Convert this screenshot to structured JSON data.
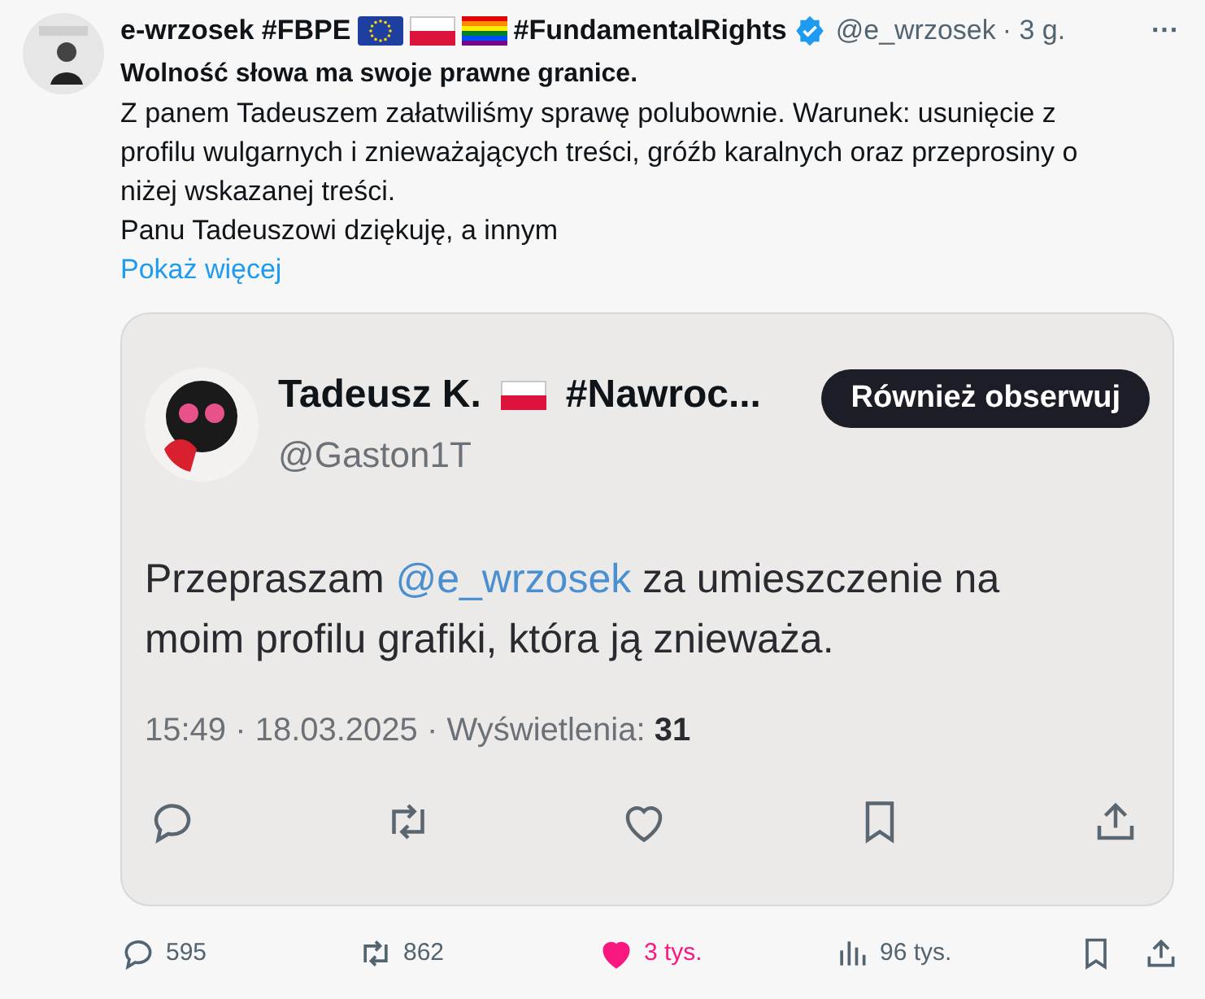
{
  "post": {
    "author": {
      "name_parts": [
        "e-wrzosek #FBPE",
        "#FundamentalRights"
      ],
      "handle": "@e_wrzosek",
      "time": "· 3 g.",
      "verified": true
    },
    "more": "···",
    "headline": "Wolność słowa ma swoje prawne granice.",
    "body": "Z panem Tadeuszem załatwiliśmy sprawę polubownie. Warunek: usunięcie z profilu wulgarnych i znieważających treści, gróźb karalnych oraz przeprosiny o niżej wskazanej treści.",
    "body_2": "Panu Tadeuszowi dziękuję, a innym",
    "show_more": "Pokaż więcej",
    "embedded": {
      "name": "Tadeusz K.",
      "name_rest": "#Nawroc...",
      "handle": "@Gaston1T",
      "follow": "Również obserwuj",
      "text_before": "Przepraszam ",
      "mention": "@e_wrzosek",
      "text_after": " za umieszczenie na moim profilu grafiki, która ją znieważa.",
      "meta": "15:49 · 18.03.2025 · Wyświetlenia: ",
      "views": "31"
    },
    "stats": [
      {
        "kind": "reply",
        "label": "595",
        "active": false
      },
      {
        "kind": "repost",
        "label": "862",
        "active": false
      },
      {
        "kind": "like",
        "label": "3 tys.",
        "active": true
      },
      {
        "kind": "views",
        "label": "96 tys.",
        "active": false
      }
    ]
  }
}
